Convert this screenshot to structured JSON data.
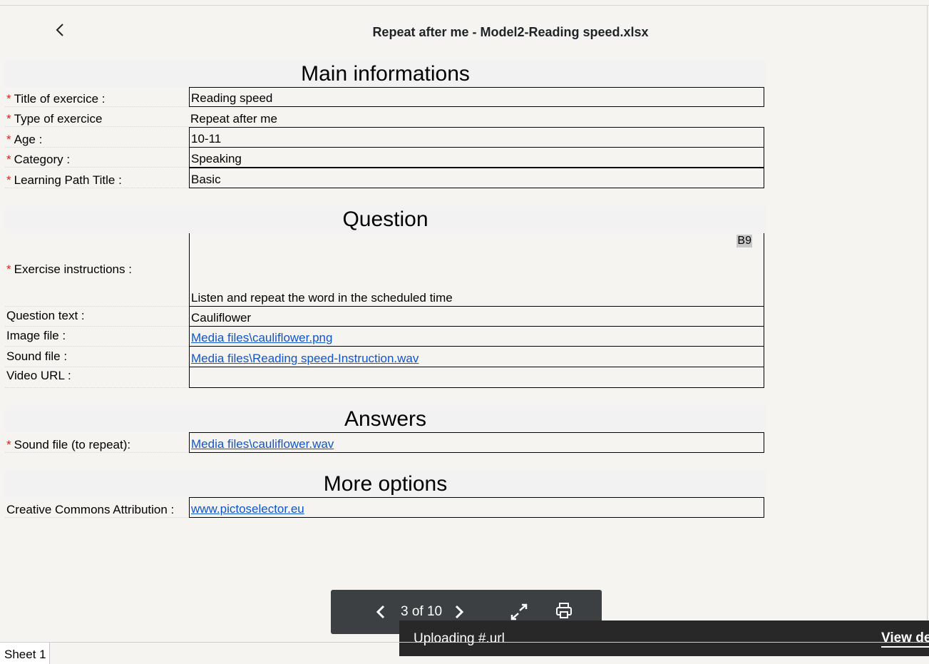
{
  "header": {
    "title": "Repeat after me - Model2-Reading speed.xlsx"
  },
  "sections": {
    "main": "Main informations",
    "question": "Question",
    "answers": "Answers",
    "more": "More options"
  },
  "main_rows": [
    {
      "label": "Title of exercice :",
      "value": "Reading speed"
    },
    {
      "label": "Type of exercice",
      "value": "Repeat after me"
    },
    {
      "label": "Age :",
      "value": "10-11"
    },
    {
      "label": "Category :",
      "value": "Speaking"
    },
    {
      "label": "Learning Path Title :",
      "value": "Basic"
    }
  ],
  "question_rows": [
    {
      "label": "Exercise instructions :",
      "value": "Listen and repeat the word in the scheduled time",
      "cell_ref": "B9"
    },
    {
      "label": "Question text :",
      "value": "Cauliflower"
    },
    {
      "label": "Image file :",
      "value": "Media files\\cauliflower.png"
    },
    {
      "label": "Sound file :",
      "value": "Media files\\Reading speed-Instruction.wav"
    },
    {
      "label": "Video URL :",
      "value": ""
    }
  ],
  "answer_rows": [
    {
      "label": "Sound file (to repeat):",
      "value": "Media files\\cauliflower.wav"
    }
  ],
  "more_rows": [
    {
      "label": "Creative Commons Attribution :",
      "value": "www.pictoselector.eu"
    }
  ],
  "required_marker": "*",
  "pager": {
    "count": "3 of 10"
  },
  "toast": {
    "message": "Uploading #.url",
    "action": "View de"
  },
  "sheet_tab": "Sheet 1",
  "colors": {
    "required": "#e0201b",
    "link": "#1155cc",
    "pager_bg": "#3c4043",
    "toast_bg": "#282828"
  },
  "icons": [
    "chevron-left-icon",
    "chevron-right-icon",
    "expand-icon",
    "print-icon"
  ]
}
